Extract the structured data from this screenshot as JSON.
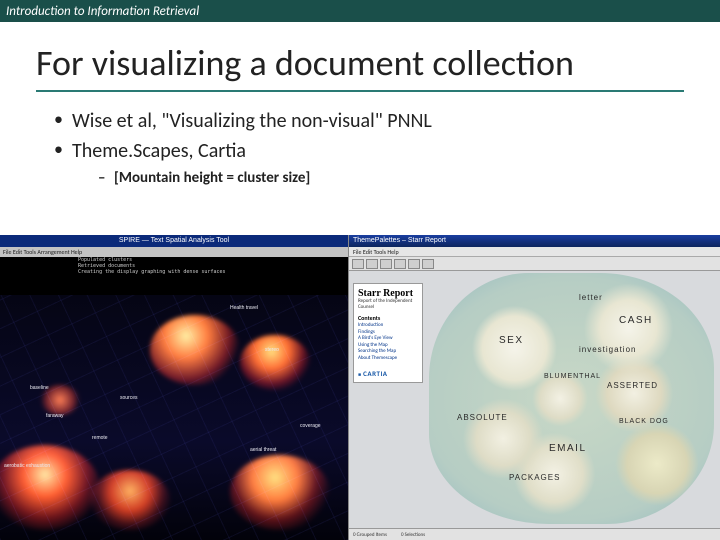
{
  "header": {
    "label": "Introduction to Information Retrieval"
  },
  "title": "For visualizing a document collection",
  "bullets": {
    "level1": [
      "Wise et al, \"Visualizing the non-visual\" PNNL",
      "Theme.Scapes, Cartia"
    ],
    "level2": [
      "[Mountain height = cluster size]"
    ]
  },
  "left_vis": {
    "window_title": "SPIRE — Text Spatial Analysis Tool",
    "menu": "File  Edit  Tools  Arrangement  Help",
    "log": "Populated clusters\nRetrieved documents\nCreating the display graphing with dense surfaces",
    "labels": [
      "Health travel",
      "stereo",
      "baseline",
      "faraway",
      "aerobatic exhaustion",
      "remote",
      "sources",
      "aerial threat",
      "coverage"
    ]
  },
  "right_vis": {
    "window_title": "ThemePalettes – Starr Report",
    "menu": "File  Edit  Tools  Help",
    "side": {
      "title": "Starr Report",
      "subtitle": "Report of the Independent Counsel",
      "contents_head": "Contents",
      "links": [
        "Introduction",
        "Findings",
        "A Bird's Eye View",
        "Using the Map",
        "Searching the Map",
        "About Themescape"
      ],
      "brand": "CARTIA"
    },
    "map_labels": {
      "m1": "letter",
      "m2": "CASH",
      "m3": "SEX",
      "m4": "investigation",
      "m5": "BLUMENTHAL",
      "m6": "ASSERTED",
      "m7": "ABSOLUTE",
      "m8": "BLACK DOG",
      "m9": "EMAIL",
      "m10": "PACKAGES"
    },
    "status": {
      "a": "0 Grouped Items",
      "b": "0 Selections"
    }
  }
}
